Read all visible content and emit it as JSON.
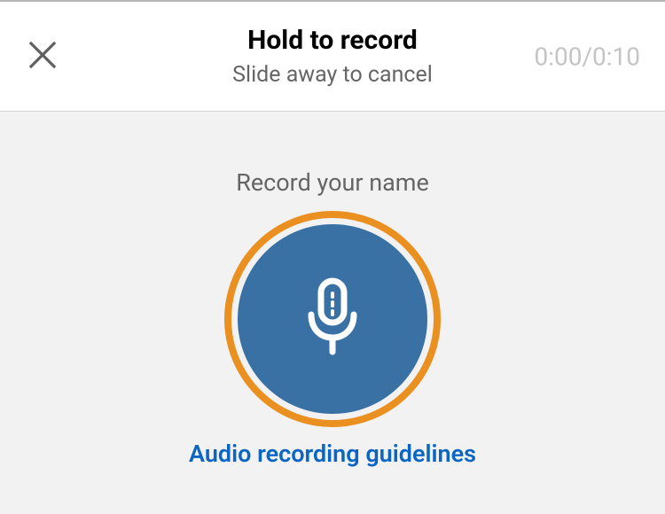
{
  "header": {
    "title": "Hold to record",
    "subtitle": "Slide away to cancel",
    "timer": "0:00/0:10"
  },
  "content": {
    "prompt": "Record your name",
    "guidelines_link": "Audio recording guidelines"
  }
}
